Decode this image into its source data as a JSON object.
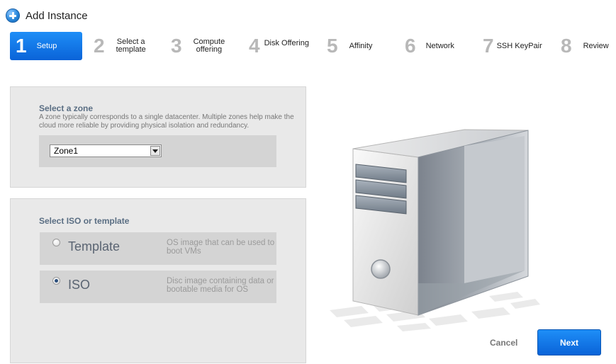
{
  "header": {
    "title": "Add Instance",
    "icon": "add-plus-icon"
  },
  "steps": [
    {
      "num": "1",
      "label": "Setup"
    },
    {
      "num": "2",
      "label_line1": "Select a",
      "label_line2": "template"
    },
    {
      "num": "3",
      "label_line1": "Compute",
      "label_line2": "offering"
    },
    {
      "num": "4",
      "label": "Disk Offering"
    },
    {
      "num": "5",
      "label": "Affinity"
    },
    {
      "num": "6",
      "label": "Network"
    },
    {
      "num": "7",
      "label": "SSH KeyPair"
    },
    {
      "num": "8",
      "label": "Review"
    }
  ],
  "active_step": "1",
  "zone": {
    "title": "Select a zone",
    "description": "A zone typically corresponds to a single datacenter. Multiple zones help make the cloud more reliable by providing physical isolation and redundancy.",
    "selected": "Zone1"
  },
  "source": {
    "title": "Select ISO or template",
    "options": [
      {
        "name": "Template",
        "description": "OS image that can be used to boot VMs",
        "checked": false
      },
      {
        "name": "ISO",
        "description": "Disc image containing data or bootable media for OS",
        "checked": true
      }
    ]
  },
  "buttons": {
    "cancel": "Cancel",
    "next": "Next"
  },
  "colors": {
    "accent": "#1479e8",
    "panel": "#e9e9e9",
    "inner_panel": "#d4d4d4",
    "title": "#5a6e83"
  }
}
